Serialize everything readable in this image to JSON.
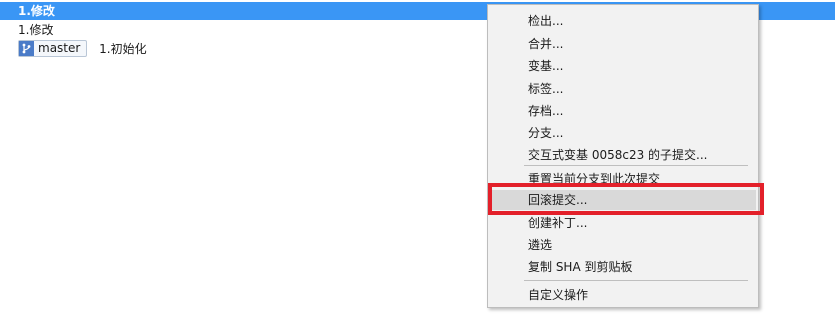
{
  "commits": [
    {
      "message": "1.修改",
      "selected": true
    },
    {
      "message": "1.修改"
    },
    {
      "branch": "master",
      "message": "1.初始化"
    }
  ],
  "context_menu": {
    "items": [
      {
        "label": "检出..."
      },
      {
        "label": "合并..."
      },
      {
        "label": "变基..."
      },
      {
        "label": "标签..."
      },
      {
        "label": "存档..."
      },
      {
        "label": "分支..."
      },
      {
        "label": "交互式变基 0058c23 的子提交..."
      },
      {
        "label": "重置当前分支到此次提交"
      },
      {
        "label": "回滚提交...",
        "hovered": true,
        "annotated": true
      },
      {
        "label": "创建补丁..."
      },
      {
        "label": "遴选"
      },
      {
        "label": "复制 SHA 到剪贴板"
      },
      {
        "label": "自定义操作"
      }
    ]
  },
  "colors": {
    "selection": "#3a96f5",
    "menu_background": "#f2f2f2",
    "menu_hover": "#d9d9d9",
    "annotation": "#e3202a",
    "branch_icon": "#4a7bc8"
  },
  "icons": {
    "branch_tag": "git-branch-icon"
  }
}
